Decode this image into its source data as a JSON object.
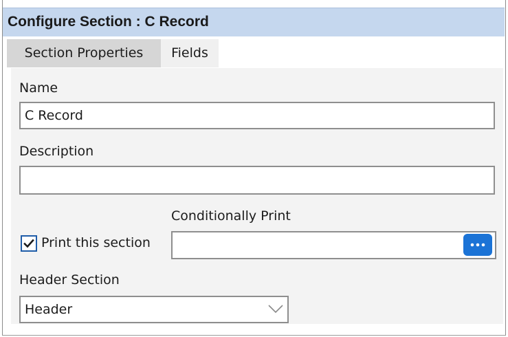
{
  "window": {
    "title": "Configure Section : C Record"
  },
  "tabs": [
    {
      "label": "Section Properties",
      "active": true
    },
    {
      "label": "Fields",
      "active": false
    }
  ],
  "form": {
    "name_label": "Name",
    "name_value": "C Record",
    "description_label": "Description",
    "description_value": "",
    "conditionally_print_label": "Conditionally Print",
    "conditionally_print_value": "",
    "print_section_label": "Print this section",
    "print_section_checked": true,
    "header_section_label": "Header Section",
    "header_section_value": "Header"
  },
  "colors": {
    "titlebar": "#c5d7ee",
    "accent": "#1b73d6",
    "panel": "#f3f3f3"
  },
  "icons": {
    "checkbox": "checkmark-icon",
    "ellipsis": "ellipsis-icon",
    "dropdown": "chevron-down-icon"
  }
}
